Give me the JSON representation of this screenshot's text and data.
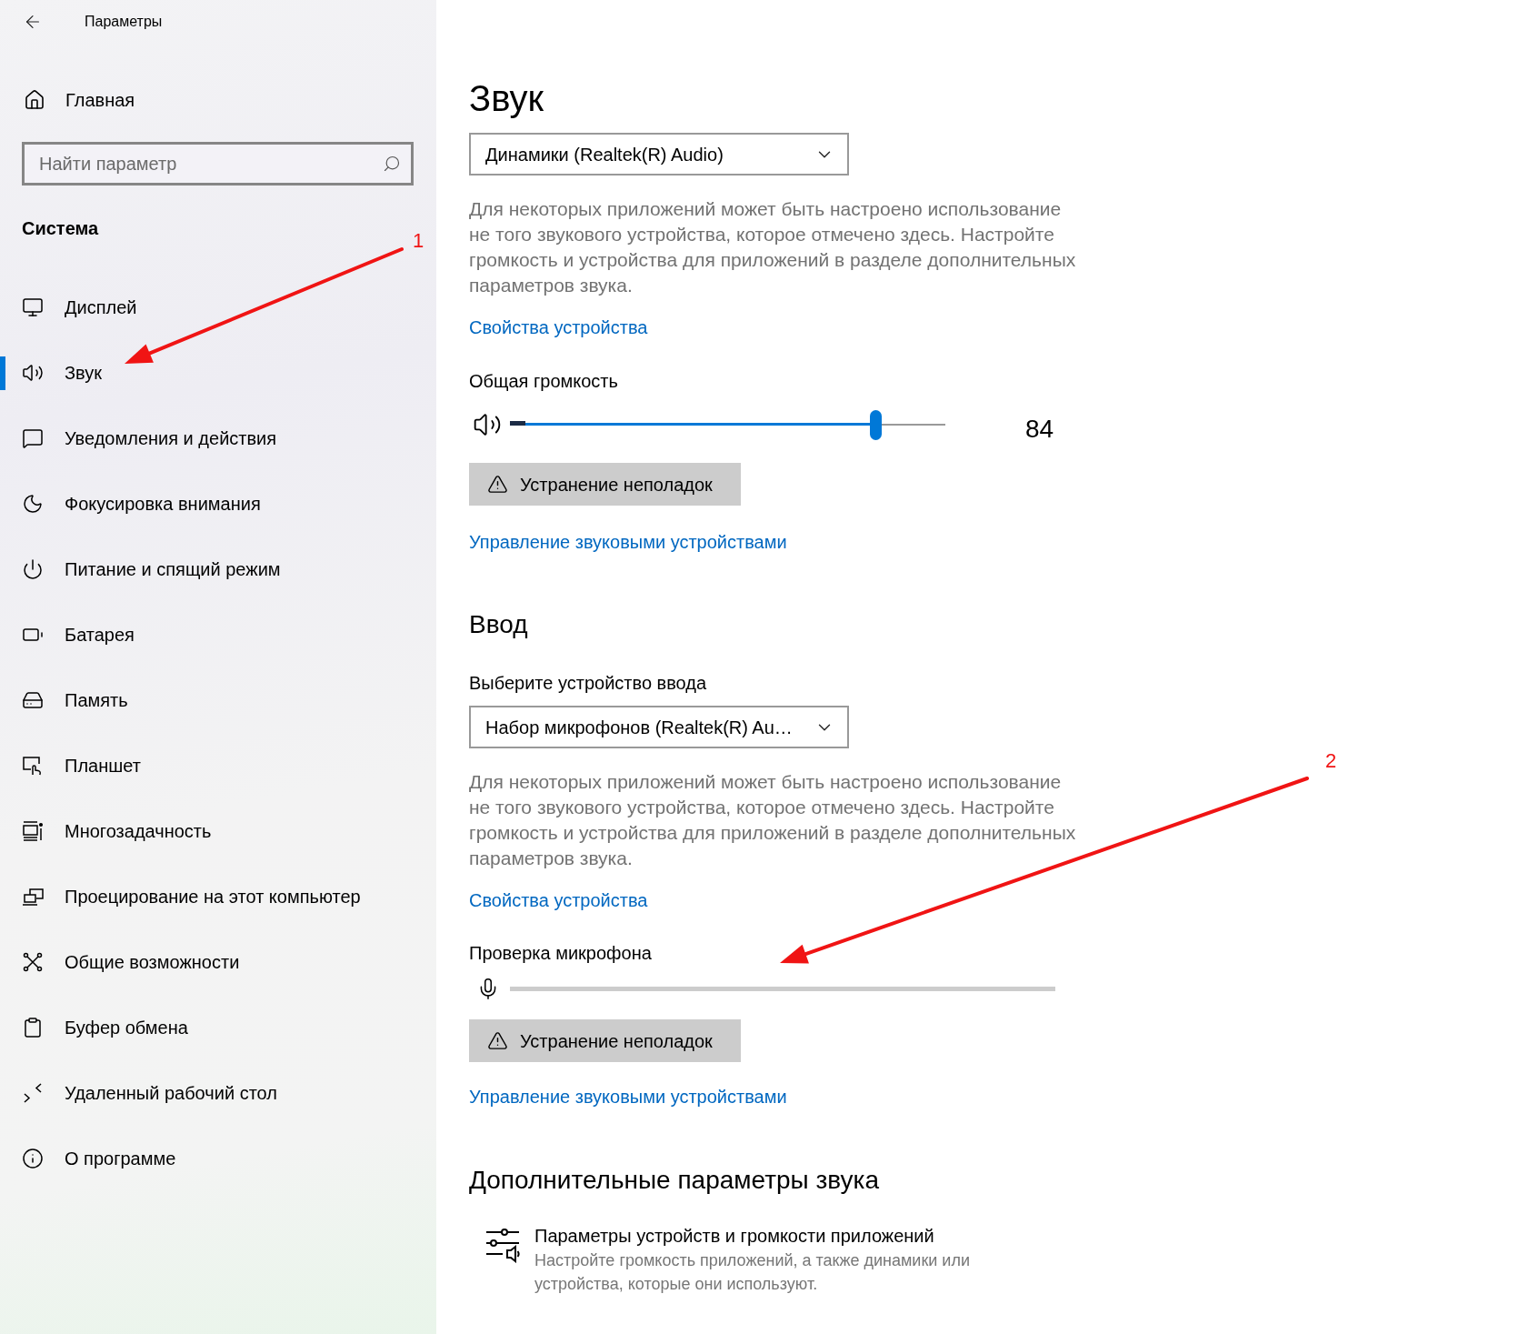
{
  "window": {
    "title": "Параметры"
  },
  "sidebar": {
    "home": "Главная",
    "search": {
      "placeholder": "Найти параметр"
    },
    "section": "Система",
    "items": [
      {
        "label": "Дисплей",
        "selected": false
      },
      {
        "label": "Звук",
        "selected": true
      },
      {
        "label": "Уведомления и действия",
        "selected": false
      },
      {
        "label": "Фокусировка внимания",
        "selected": false
      },
      {
        "label": "Питание и спящий режим",
        "selected": false
      },
      {
        "label": "Батарея",
        "selected": false
      },
      {
        "label": "Память",
        "selected": false
      },
      {
        "label": "Планшет",
        "selected": false
      },
      {
        "label": "Многозадачность",
        "selected": false
      },
      {
        "label": "Проецирование на этот компьютер",
        "selected": false
      },
      {
        "label": "Общие возможности",
        "selected": false
      },
      {
        "label": "Буфер обмена",
        "selected": false
      },
      {
        "label": "Удаленный рабочий стол",
        "selected": false
      },
      {
        "label": "О программе",
        "selected": false
      }
    ]
  },
  "page": {
    "title": "Звук"
  },
  "output": {
    "device": "Динамики (Realtek(R) Audio)",
    "note": "Для некоторых приложений может быть настроено использование не того звукового устройства, которое отмечено здесь. Настройте громкость и устройства для приложений в разделе дополнительных параметров звука.",
    "properties_link": "Свойства устройства",
    "volume": {
      "label": "Общая громкость",
      "level": 0.84,
      "reading": "84"
    },
    "meter": {
      "level": 0.035
    },
    "troubleshoot": "Устранение неполадок",
    "manage_link": "Управление звуковыми устройствами"
  },
  "input": {
    "heading": "Ввод",
    "device_label": "Выберите устройство ввода",
    "device": "Набор микрофонов (Realtek(R) Au…",
    "note": "Для некоторых приложений может быть настроено использование не того звукового устройства, которое отмечено здесь. Настройте громкость и устройства для приложений в разделе дополнительных параметров звука.",
    "properties_link": "Свойства устройства",
    "test": {
      "label": "Проверка микрофона",
      "level": 0
    },
    "troubleshoot": "Устранение неполадок",
    "manage_link": "Управление звуковыми устройствами"
  },
  "advanced": {
    "heading": "Дополнительные параметры звука",
    "items": [
      {
        "title": "Параметры устройств и громкости приложений",
        "description": "Настройте громкость приложений, а также динамики или устройства, которые они используют."
      }
    ]
  },
  "annotations": [
    {
      "label": "1"
    },
    {
      "label": "2"
    }
  ]
}
